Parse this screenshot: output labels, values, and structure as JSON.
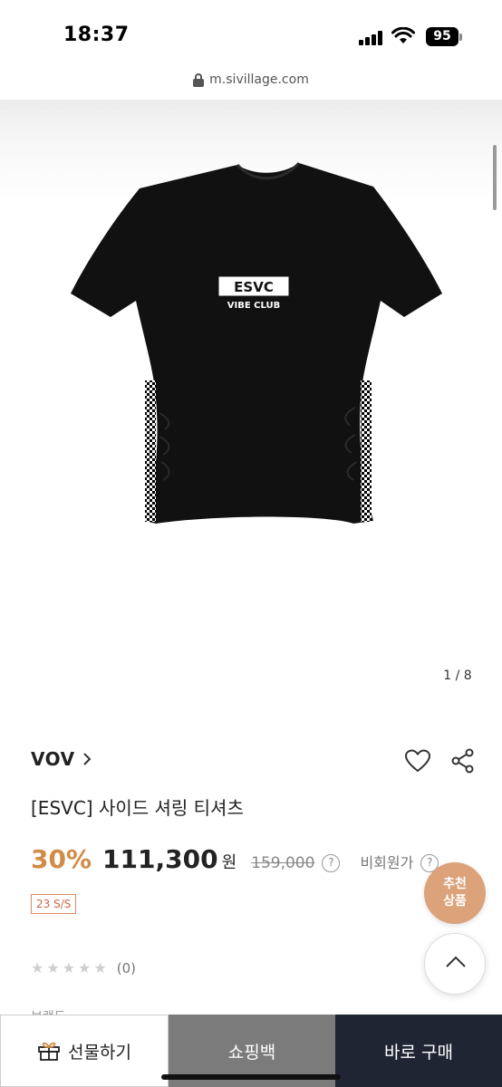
{
  "status_bar": {
    "time": "18:37",
    "battery": "95"
  },
  "browser": {
    "url": "m.sivillage.com"
  },
  "gallery": {
    "counter": "1 / 8",
    "logo_text_1": "ESVC",
    "logo_text_2": "VIBE CLUB"
  },
  "product": {
    "brand": "VOV",
    "brand_chevron": "›",
    "title": "[ESVC] 사이드 셔링 티셔츠",
    "discount": "30%",
    "sale_price": "111,300",
    "currency": "원",
    "original_price": "159,000",
    "help_mark": "?",
    "nonmember_label": "비회원가",
    "season_badge": "23 S/S",
    "rating_stars": 0,
    "review_count": "(0)",
    "cut_text": "브랜드"
  },
  "floating": {
    "recommend_line1": "추천",
    "recommend_line2": "상품"
  },
  "bottom_bar": {
    "gift_label": "선물하기",
    "cart_label": "쇼핑백",
    "buy_label": "바로 구매"
  },
  "colors": {
    "accent": "#d18b45",
    "recommend_bg": "#dca27a",
    "cart_bg": "#7b7b7b",
    "buy_bg": "#1f2533"
  }
}
